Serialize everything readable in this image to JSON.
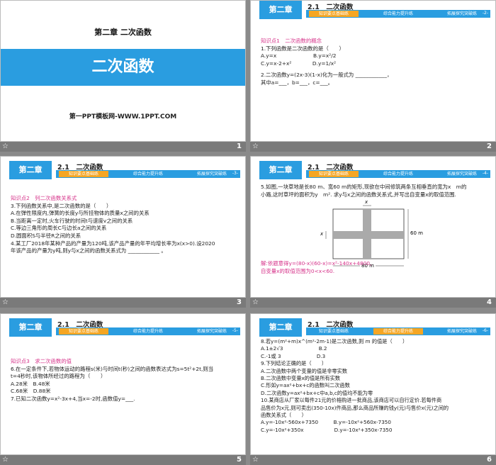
{
  "slide1": {
    "chapter": "第二章 二次函数",
    "title": "二次函数",
    "footer": "第一PPT模板网-WWW.1PPT.COM",
    "num": "1"
  },
  "header": {
    "chapter": "第二章",
    "section": "2.1　二次函数",
    "tabs": [
      "知识要点基础练",
      "综合能力提升练",
      "拓展探究突破练"
    ]
  },
  "slide2": {
    "page": "-2-",
    "num": "2",
    "lines": [
      "知识点1　二次函数的概念",
      "1.下列函数是二次函数的是（　　）",
      "A.y=x　　　　　　　B.y=x²/2",
      "C.y=x-2+x²　　　　D.y=1/x²",
      "2.二次函数y=(2x-3)(1-x)化为一般式为 ____________，",
      "其中a=___，b=___，c=___。"
    ]
  },
  "slide3": {
    "page": "-3-",
    "num": "3",
    "lines": [
      "知识点2　列二次函数关系式",
      "3.下列函数关系中,是二次函数的是（　　）",
      "A.在弹性限度内,弹簧的长度y与所挂物体的质量x之间的关系",
      "B.当距离一定时,火车行驶的时间t与速度v之间的关系",
      "C.等边三角形的周长C与边长a之间的关系",
      "D.圆面积S与半径R之间的关系",
      "4.某工厂2018年某种产品的产量为120吨,该产品产量的年平均增长率为x(x>0).设2020",
      "年该产品的产量为y吨,则y与x之间的函数关系式为 ____________ 。"
    ]
  },
  "slide4": {
    "page": "-4-",
    "num": "4",
    "lines": [
      "5.如图,一块草地是长80 m、宽60 m的矩形,现欲在中间修筑两条互相垂直的宽为x　m的",
      "小路,这时草坪的面积为y　m². 求y与x之间的函数关系式,并写出自变量x的取值范围."
    ],
    "answer": [
      "解:依题意得y=(80-x)(60-x)=x²-140x+4800,",
      "自变量x的取值范围为0<x<60."
    ],
    "fig": {
      "label_x1": "x",
      "label_x2": "x",
      "label_h": "60 m",
      "label_w": "80 m"
    }
  },
  "slide5": {
    "page": "-5-",
    "num": "5",
    "lines": [
      "知识点3　求二次函数的值",
      "6.在一定条件下,若物体运动的路程s(米)与时间t(秒)之间的函数表达式为s=5t²+2t,则当",
      "t=4秒时,该物体所经过的路程为（　　）",
      "A.28米　B.48米",
      "C.68米　D.88米",
      "7.已知二次函数y=x²-3x+4,当x=-2时,函数值y=___."
    ]
  },
  "slide6": {
    "page": "-6-",
    "num": "6",
    "lines": [
      "8.若y=(m²+m)x^(m²-2m-1)是二次函数,则 m 的值是（　　）",
      "A.1±2√3　　　　　　　B.2",
      "C.-1或 3　　　　　　　D.3",
      "9.下列结论正确的是（　　）",
      "A.二次函数中两个变量的值是非零实数",
      "B.二次函数中变量x的值是所有实数",
      "C.形如y=ax²+bx+c的函数叫二次函数",
      "D.二次函数y=ax²+bx+c中a,b,c的值均不能为零",
      "10.某商店从厂家以每件21元的价格购进一批商品,该商店可以自行定价.若每件商",
      "品售价为x元,则可卖出(350-10x)件商品,那么商品所赚的钱y(元)与售价x(元)之间的",
      "函数关系式（　　）",
      "A.y=-10x²-560x+7350　　　B.y=-10x²+560x-7350",
      "C.y=-10x²+350x　　　　　　D.y=-10x²+350x-7350"
    ]
  }
}
